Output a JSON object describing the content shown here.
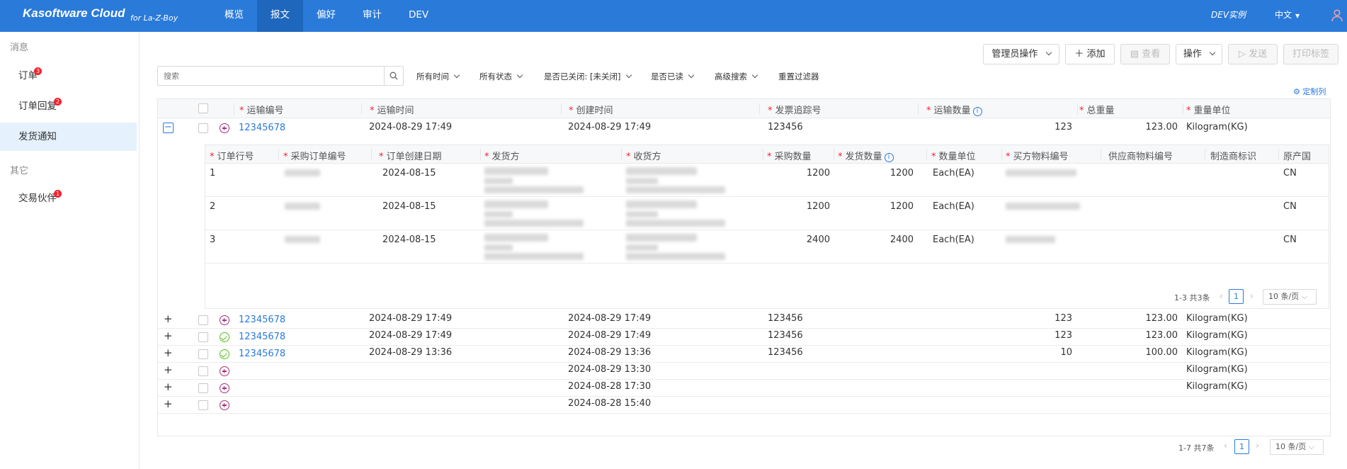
{
  "header": {
    "brand": "Kasoftware Cloud",
    "brand_sub": "for La-Z-Boy",
    "nav": [
      "概览",
      "报文",
      "偏好",
      "审计",
      "DEV"
    ],
    "active_nav": "报文",
    "instance": "DEV实例",
    "language": "中文",
    "user_icon": "user-icon"
  },
  "sidebar": {
    "group1": "消息",
    "items1": [
      {
        "label": "订单",
        "badge": "3"
      },
      {
        "label": "订单回复",
        "badge": "2"
      },
      {
        "label": "发货通知",
        "badge": ""
      }
    ],
    "group2": "其它",
    "items2": [
      {
        "label": "交易伙伴",
        "badge": "1"
      }
    ]
  },
  "toolbar": {
    "admin": "管理员操作",
    "add": "添加",
    "view": "查看",
    "ops": "操作",
    "send": "发送",
    "print": "打印标签"
  },
  "search": {
    "placeholder": "搜索"
  },
  "filters": {
    "time": "所有时间",
    "status": "所有状态",
    "closed": "是否已关闭: [未关闭]",
    "read": "是否已读",
    "advanced": "高级搜索",
    "reset": "重置过滤器"
  },
  "customize": "定制列",
  "columns": {
    "ship_no": "运输编号",
    "ship_time": "运输时间",
    "created": "创建时间",
    "invoice": "发票追踪号",
    "ship_qty": "运输数量",
    "weight": "总重量",
    "weight_unit": "重量单位"
  },
  "rows": [
    {
      "ship_no": "12345678",
      "ship_time": "2024-08-29 17:49",
      "created": "2024-08-29 17:49",
      "invoice": "123456",
      "qty": "123",
      "weight": "123.00",
      "unit": "Kilogram(KG)",
      "status": "pending"
    },
    {
      "ship_no": "12345678",
      "ship_time": "2024-08-29 17:49",
      "created": "2024-08-29 17:49",
      "invoice": "123456",
      "qty": "123",
      "weight": "123.00",
      "unit": "Kilogram(KG)",
      "status": "pending"
    },
    {
      "ship_no": "12345678",
      "ship_time": "2024-08-29 17:49",
      "created": "2024-08-29 17:49",
      "invoice": "123456",
      "qty": "123",
      "weight": "123.00",
      "unit": "Kilogram(KG)",
      "status": "ok"
    },
    {
      "ship_no": "12345678",
      "ship_time": "2024-08-29 13:36",
      "created": "2024-08-29 13:36",
      "invoice": "123456",
      "qty": "10",
      "weight": "100.00",
      "unit": "Kilogram(KG)",
      "status": "ok"
    },
    {
      "ship_no": "",
      "ship_time": "",
      "created": "2024-08-29 13:30",
      "invoice": "",
      "qty": "",
      "weight": "",
      "unit": "Kilogram(KG)",
      "status": "pending"
    },
    {
      "ship_no": "",
      "ship_time": "",
      "created": "2024-08-28 17:30",
      "invoice": "",
      "qty": "",
      "weight": "",
      "unit": "Kilogram(KG)",
      "status": "pending"
    },
    {
      "ship_no": "",
      "ship_time": "",
      "created": "2024-08-28 15:40",
      "invoice": "",
      "qty": "",
      "weight": "",
      "unit": "",
      "status": "pending"
    }
  ],
  "sub_columns": {
    "line": "订单行号",
    "po": "采购订单编号",
    "po_date": "订单创建日期",
    "shipper": "发货方",
    "receiver": "收货方",
    "order_qty": "采购数量",
    "ship_qty": "发货数量",
    "unit": "数量单位",
    "buyer_part": "买方物料编号",
    "supplier_part": "供应商物料编号",
    "mfr": "制造商标识",
    "origin": "原产国"
  },
  "sub_rows": [
    {
      "line": "1",
      "po_date": "2024-08-15",
      "order_qty": "1200",
      "ship_qty": "1200",
      "unit": "Each(EA)",
      "origin": "CN"
    },
    {
      "line": "2",
      "po_date": "2024-08-15",
      "order_qty": "1200",
      "ship_qty": "1200",
      "unit": "Each(EA)",
      "origin": "CN"
    },
    {
      "line": "3",
      "po_date": "2024-08-15",
      "order_qty": "2400",
      "ship_qty": "2400",
      "unit": "Each(EA)",
      "origin": "CN"
    }
  ],
  "sub_pager": {
    "total": "1-3 共3条",
    "page": "1",
    "size": "10 条/页"
  },
  "pager": {
    "total": "1-7 共7条",
    "page": "1",
    "size": "10 条/页"
  }
}
